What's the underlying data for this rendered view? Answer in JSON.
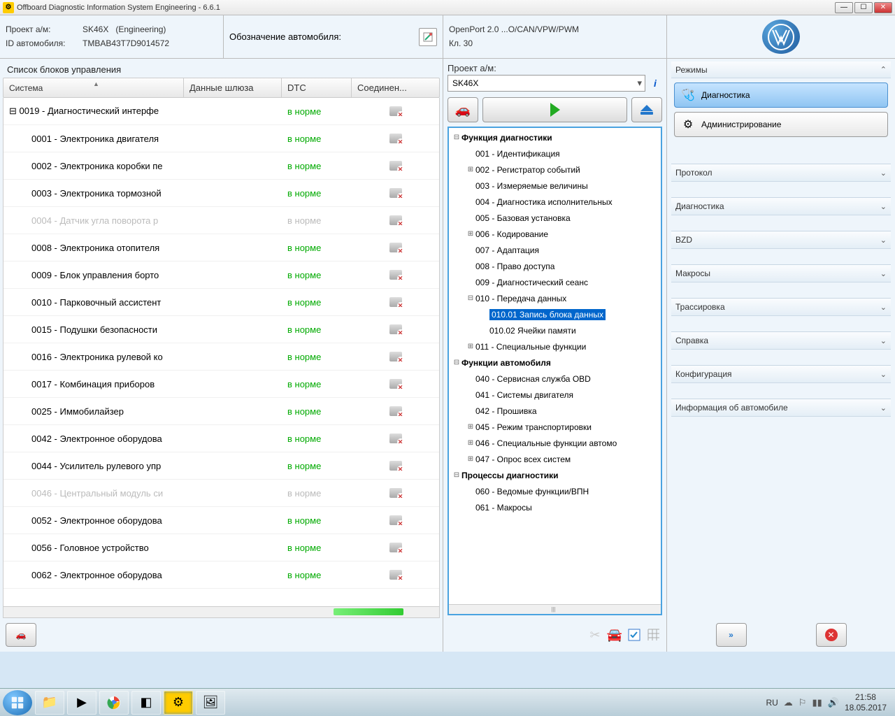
{
  "window": {
    "title": "Offboard Diagnostic Information System Engineering - 6.6.1"
  },
  "header": {
    "project_label": "Проект а/м:",
    "project_value": "SK46X",
    "project_mode": "(Engineering)",
    "id_label": "ID автомобиля:",
    "id_value": "TMBAB43T7D9014572",
    "vehicle_label": "Обозначение автомобиля:",
    "port": "OpenPort 2.0 ...O/CAN/VPW/PWM",
    "kl": "Кл. 30"
  },
  "table": {
    "title": "Список блоков управления",
    "columns": {
      "system": "Система",
      "gateway": "Данные шлюза",
      "dtc": "DTC",
      "conn": "Соединен..."
    },
    "dtc_norm": "в норме",
    "rows": [
      {
        "name": "0019 - Диагностический интерфе",
        "dtc": "в норме",
        "disabled": false,
        "root": true
      },
      {
        "name": "0001 - Электроника двигателя",
        "dtc": "в норме",
        "disabled": false
      },
      {
        "name": "0002 - Электроника коробки пе",
        "dtc": "в норме",
        "disabled": false
      },
      {
        "name": "0003 - Электроника тормозной",
        "dtc": "в норме",
        "disabled": false
      },
      {
        "name": "0004 - Датчик угла поворота р",
        "dtc": "в норме",
        "disabled": true
      },
      {
        "name": "0008 - Электроника отопителя",
        "dtc": "в норме",
        "disabled": false
      },
      {
        "name": "0009 - Блок управления борто",
        "dtc": "в норме",
        "disabled": false
      },
      {
        "name": "0010 - Парковочный ассистент",
        "dtc": "в норме",
        "disabled": false
      },
      {
        "name": "0015 - Подушки безопасности",
        "dtc": "в норме",
        "disabled": false
      },
      {
        "name": "0016 - Электроника рулевой ко",
        "dtc": "в норме",
        "disabled": false
      },
      {
        "name": "0017 - Комбинация приборов",
        "dtc": "в норме",
        "disabled": false
      },
      {
        "name": "0025 - Иммобилайзер",
        "dtc": "в норме",
        "disabled": false
      },
      {
        "name": "0042 - Электронное оборудова",
        "dtc": "в норме",
        "disabled": false
      },
      {
        "name": "0044 - Усилитель рулевого упр",
        "dtc": "в норме",
        "disabled": false
      },
      {
        "name": "0046 - Центральный модуль си",
        "dtc": "в норме",
        "disabled": true
      },
      {
        "name": "0052 - Электронное оборудова",
        "dtc": "в норме",
        "disabled": false
      },
      {
        "name": "0056 - Головное устройство",
        "dtc": "в норме",
        "disabled": false
      },
      {
        "name": "0062 - Электронное оборудова",
        "dtc": "в норме",
        "disabled": false
      }
    ]
  },
  "mid": {
    "project_label": "Проект а/м:",
    "project_value": "SK46X",
    "tree": {
      "g1": "Функция диагностики",
      "i001": "001 - Идентификация",
      "i002": "002 - Регистратор событий",
      "i003": "003 - Измеряемые величины",
      "i004": "004 - Диагностика исполнительных",
      "i005": "005 - Базовая установка",
      "i006": "006 - Кодирование",
      "i007": "007 - Адаптация",
      "i008": "008 - Право доступа",
      "i009": "009 - Диагностический сеанс",
      "i010": "010 - Передача данных",
      "i010_01": "010.01 Запись блока данных",
      "i010_02": "010.02 Ячейки памяти",
      "i011": "011 - Специальные функции",
      "g2": "Функции автомобиля",
      "i040": "040 - Сервисная служба OBD",
      "i041": "041 - Системы двигателя",
      "i042": "042 - Прошивка",
      "i045": "045 - Режим транспортировки",
      "i046": "046 - Специальные функции автомо",
      "i047": "047 - Опрос всех систем",
      "g3": "Процессы диагностики",
      "i060": "060 - Ведомые функции/ВПН",
      "i061": "061 - Макросы"
    }
  },
  "modes": {
    "title": "Режимы",
    "diag": "Диагностика",
    "admin": "Администрирование",
    "sections": {
      "protocol": "Протокол",
      "diagnostics": "Диагностика",
      "bzd": "BZD",
      "macros": "Макросы",
      "trace": "Трассировка",
      "help": "Справка",
      "config": "Конфигурация",
      "vehinfo": "Информация об автомобиле"
    }
  },
  "taskbar": {
    "lang": "RU",
    "time": "21:58",
    "date": "18.05.2017"
  }
}
